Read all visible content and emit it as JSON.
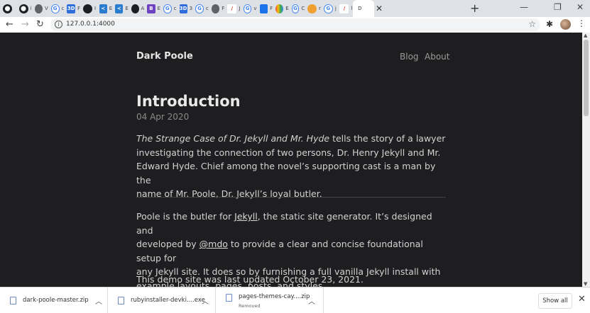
{
  "browser": {
    "tabs": [
      {
        "icon": "github-icon",
        "color": "#1b1f23",
        "label": ""
      },
      {
        "icon": "github-icon",
        "color": "#1b1f23",
        "label": "i"
      },
      {
        "icon": "globe-icon",
        "color": "#5f6368",
        "label": "V"
      },
      {
        "icon": "google-icon",
        "color": "#4285f4",
        "label": "c"
      },
      {
        "icon": "3d-icon",
        "color": "#2f6fdc",
        "label": "F"
      },
      {
        "icon": "github-icon",
        "color": "#1b1f23",
        "label": "I"
      },
      {
        "icon": "vscode-icon",
        "color": "#2a7ccf",
        "label": "E"
      },
      {
        "icon": "vscode-icon",
        "color": "#2a7ccf",
        "label": "E"
      },
      {
        "icon": "github-icon",
        "color": "#1b1f23",
        "label": "A"
      },
      {
        "icon": "bootstrap-icon",
        "color": "#6f42c1",
        "label": "E"
      },
      {
        "icon": "google-icon",
        "color": "#4285f4",
        "label": "c"
      },
      {
        "icon": "3d-icon",
        "color": "#2f6fdc",
        "label": "3"
      },
      {
        "icon": "google-icon",
        "color": "#4285f4",
        "label": "c"
      },
      {
        "icon": "globe-icon",
        "color": "#5f6368",
        "label": "F"
      },
      {
        "icon": "pencil-icon",
        "color": "#d93025",
        "label": "J"
      },
      {
        "icon": "google-icon",
        "color": "#4285f4",
        "label": "v"
      },
      {
        "icon": "board-icon",
        "color": "#1a73e8",
        "label": "F"
      },
      {
        "icon": "cloud-icon",
        "color": "#e8453c",
        "label": "E"
      },
      {
        "icon": "google-icon",
        "color": "#4285f4",
        "label": "C"
      },
      {
        "icon": "hand-icon",
        "color": "#f0a030",
        "label": "r"
      },
      {
        "icon": "google-icon",
        "color": "#4285f4",
        "label": "j"
      },
      {
        "icon": "pencil-icon",
        "color": "#d93025",
        "label": "l"
      }
    ],
    "active_tab": {
      "label": "D"
    },
    "url": "127.0.0.1:4000"
  },
  "site": {
    "title": "Dark Poole",
    "nav": [
      {
        "label": "Blog"
      },
      {
        "label": "About"
      }
    ]
  },
  "post": {
    "title": "Introduction",
    "date": "04 Apr 2020",
    "lead_em": "The Strange Case of Dr. Jekyll and Mr. Hyde",
    "lead_line1": " tells the story of a lawyer",
    "lead_line2": "investigating the connection of two persons, Dr. Henry Jekyll and Mr.",
    "lead_line3": "Edward Hyde. Chief among the novel’s supporting cast is a man by the",
    "lead_line4": "name of Mr. Poole, Dr. Jekyll’s loyal butler.",
    "p2_a": "Poole is the butler for ",
    "p2_link1": "Jekyll",
    "p2_b": ", the static site generator. It’s designed and",
    "p2_c": "developed by ",
    "p2_link2": "@mdo",
    "p2_d": " to provide a clear and concise foundational setup for",
    "p2_e": "any Jekyll site. It does so by furnishing a full vanilla Jekyll install with",
    "p2_f": "example layouts, pages, posts, and styles.",
    "p3": "This demo site was last updated October 23, 2021."
  },
  "downloads": {
    "items": [
      {
        "name": "dark-poole-master.zip",
        "status": ""
      },
      {
        "name": "rubyinstaller-devki....exe",
        "status": ""
      },
      {
        "name": "pages-themes-cay....zip",
        "status": "Removed"
      }
    ],
    "show_all_label": "Show all"
  }
}
